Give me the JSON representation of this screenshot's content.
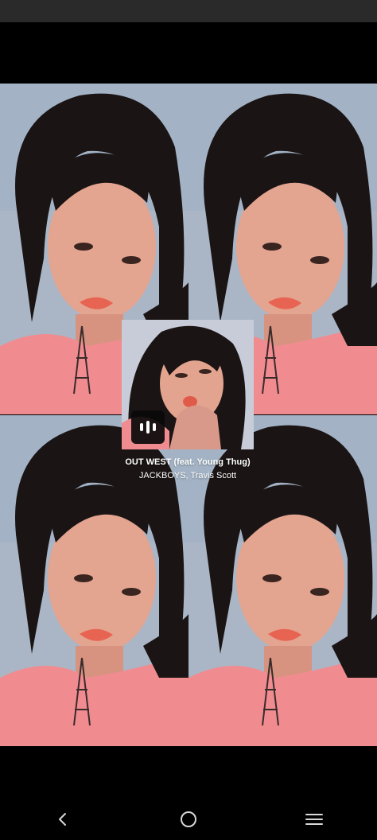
{
  "story": {
    "song": {
      "title": "OUT WEST (feat. Young Thug)",
      "artists": "JACKBOYS, Travis Scott"
    },
    "badge_icon": "audio-bars-icon"
  },
  "navigation": {
    "back_icon": "back-chevron-icon",
    "home_icon": "home-circle-icon",
    "recents_icon": "recents-menu-icon"
  },
  "colors": {
    "status_bar": "#2a2a2a",
    "background": "#000000",
    "shirt_pink": "#f08a90",
    "wall_blue": "#a9b6c7",
    "text": "#ffffff"
  }
}
